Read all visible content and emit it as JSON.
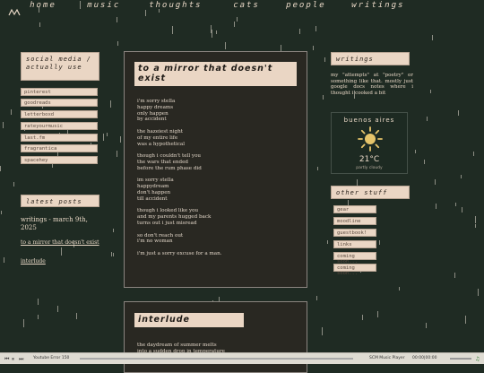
{
  "nav": {
    "items": [
      "home",
      "music",
      "thoughts",
      "cats",
      "people",
      "writings"
    ]
  },
  "social": {
    "heading": "social media / actually use",
    "links": [
      "pinterest",
      "goodreads",
      "letterboxd",
      "rateyourmusic",
      "last.fm",
      "fragrantica",
      "spacehey"
    ]
  },
  "latest_posts": {
    "heading": "latest posts",
    "date_line": "writings - march 9th, 2025",
    "links": [
      "to a mirror that doesn't exist",
      "interlude"
    ]
  },
  "post1": {
    "title": "to a mirror that doesn't exist",
    "body": "i'm sorry stella\nhappy dreams\nonly happen\nby accident\n\nthe hazeiest night\nof my entire life\nwas a hypothetical\n\nthough i couldn't tell you\nthe wars that ended\nbefore the rum phase did\n\nim sorry stella\nhappydream\ndon't happen\ntill accident\n\nthough i looked like you\nand my parents hugged back\nturns out i just misread\n\nso don't reach out\ni'm no woman\n\ni'm just a sorry excuse for a man."
  },
  "post2": {
    "title": "interlude",
    "body": "the daydream of summer melts\ninto a sudden drop in temperature"
  },
  "writings_box": {
    "heading": "writings",
    "text": "my \"attempts\" at \"poetry\" or something like that. mostly just google docs notes where i thought i cooked a bit"
  },
  "weather": {
    "city": "buenos aires",
    "temp": "21°C",
    "desc": "partly cloudy",
    "icon": "sun-icon"
  },
  "other_stuff": {
    "heading": "other stuff",
    "links": [
      "gear",
      "moodline",
      "guestbook!",
      "links",
      "coming soon...",
      "coming soon..."
    ]
  },
  "player": {
    "error_text": "Youtube Error 150",
    "title": "SCM Music Player",
    "time": "00:00|00:00"
  },
  "colors": {
    "background": "#1f2b23",
    "accent": "#ead6c4",
    "post_bg": "#292822"
  }
}
